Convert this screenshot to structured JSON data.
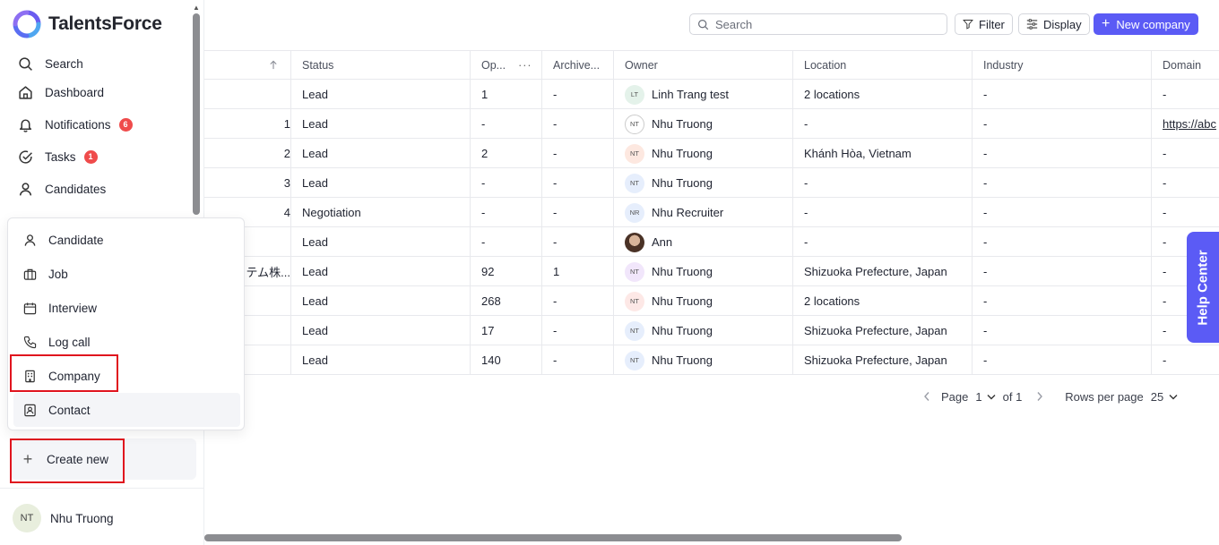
{
  "app": {
    "name": "TalentsForce"
  },
  "colors": {
    "accent": "#5b5bf5",
    "badge": "#ef4b4b",
    "highlight": "#e0141e"
  },
  "sidebar": {
    "items": [
      {
        "label": "Search",
        "icon": "search-icon"
      },
      {
        "label": "Dashboard",
        "icon": "home-icon"
      },
      {
        "label": "Notifications",
        "icon": "bell-icon",
        "badge": "6"
      },
      {
        "label": "Tasks",
        "icon": "check-circle-icon",
        "badge": "1"
      },
      {
        "label": "Candidates",
        "icon": "user-icon"
      }
    ],
    "create_new": "Create new",
    "user": {
      "initials": "NT",
      "name": "Nhu Truong"
    }
  },
  "create_menu": {
    "items": [
      {
        "label": "Candidate",
        "icon": "user-icon"
      },
      {
        "label": "Job",
        "icon": "briefcase-icon"
      },
      {
        "label": "Interview",
        "icon": "calendar-icon"
      },
      {
        "label": "Log call",
        "icon": "phone-icon"
      },
      {
        "label": "Company",
        "icon": "building-icon"
      },
      {
        "label": "Contact",
        "icon": "contact-card-icon"
      }
    ]
  },
  "toolbar": {
    "search_placeholder": "Search",
    "filter_label": "Filter",
    "display_label": "Display",
    "new_company_label": "New company"
  },
  "table": {
    "columns": [
      "",
      "Status",
      "Op...",
      "Archive...",
      "Owner",
      "Location",
      "Industry",
      "Domain"
    ],
    "rows": [
      {
        "name": "",
        "status": "Lead",
        "op": "1",
        "archived": "-",
        "owner_initials": "LT",
        "owner": "Linh Trang test",
        "location": "2 locations",
        "industry": "-",
        "domain": "-"
      },
      {
        "name": "1",
        "status": "Lead",
        "op": "-",
        "archived": "-",
        "owner_initials": "NT",
        "owner": "Nhu Truong",
        "location": "-",
        "industry": "-",
        "domain": "https://abc"
      },
      {
        "name": "2",
        "status": "Lead",
        "op": "2",
        "archived": "-",
        "owner_initials": "NT",
        "owner": "Nhu Truong",
        "location": "Khánh Hòa, Vietnam",
        "industry": "-",
        "domain": "-"
      },
      {
        "name": "3",
        "status": "Lead",
        "op": "-",
        "archived": "-",
        "owner_initials": "NT",
        "owner": "Nhu Truong",
        "location": "-",
        "industry": "-",
        "domain": "-"
      },
      {
        "name": "4",
        "status": "Negotiation",
        "op": "-",
        "archived": "-",
        "owner_initials": "NR",
        "owner": "Nhu Recruiter",
        "location": "-",
        "industry": "-",
        "domain": "-"
      },
      {
        "name": "",
        "status": "Lead",
        "op": "-",
        "archived": "-",
        "owner_initials": "",
        "owner": "Ann",
        "location": "-",
        "industry": "-",
        "domain": "-"
      },
      {
        "name": "テム株...",
        "status": "Lead",
        "op": "92",
        "archived": "1",
        "owner_initials": "NT",
        "owner": "Nhu Truong",
        "location": "Shizuoka Prefecture, Japan",
        "industry": "-",
        "domain": "-"
      },
      {
        "name": "",
        "status": "Lead",
        "op": "268",
        "archived": "-",
        "owner_initials": "NT",
        "owner": "Nhu Truong",
        "location": "2 locations",
        "industry": "-",
        "domain": "-"
      },
      {
        "name": "",
        "status": "Lead",
        "op": "17",
        "archived": "-",
        "owner_initials": "NT",
        "owner": "Nhu Truong",
        "location": "Shizuoka Prefecture, Japan",
        "industry": "-",
        "domain": "-"
      },
      {
        "name": "",
        "status": "Lead",
        "op": "140",
        "archived": "-",
        "owner_initials": "NT",
        "owner": "Nhu Truong",
        "location": "Shizuoka Prefecture, Japan",
        "industry": "-",
        "domain": "-"
      }
    ]
  },
  "pagination": {
    "page_label": "Page",
    "page": "1",
    "of_label": "of 1",
    "rows_label": "Rows per page",
    "rows_value": "25"
  },
  "help_center": "Help Center"
}
